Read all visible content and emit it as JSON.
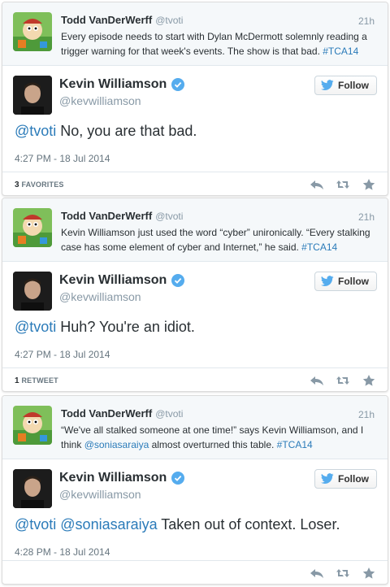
{
  "threads": [
    {
      "parent": {
        "name": "Todd VanDerWerff",
        "handle": "@tvoti",
        "time": "21h",
        "text_before": "Every episode needs to start with Dylan McDermott solemnly reading a trigger warning for that week's events. The show is that bad. ",
        "text_mention": "",
        "text_after": "",
        "hashtag": "#TCA14"
      },
      "reply": {
        "name": "Kevin Williamson",
        "handle": "@kevwilliamson",
        "follow_label": "Follow",
        "mentions": "@tvoti",
        "text": " No, you are that bad.",
        "date": "4:27 PM - 18 Jul 2014",
        "stat_count": "3",
        "stat_label": "FAVORITES"
      }
    },
    {
      "parent": {
        "name": "Todd VanDerWerff",
        "handle": "@tvoti",
        "time": "21h",
        "text_before": "Kevin Williamson just used the word “cyber” unironically. “Every stalking case has some element of cyber and Internet,” he said. ",
        "text_mention": "",
        "text_after": "",
        "hashtag": "#TCA14"
      },
      "reply": {
        "name": "Kevin Williamson",
        "handle": "@kevwilliamson",
        "follow_label": "Follow",
        "mentions": "@tvoti",
        "text": " Huh?  You're an idiot.",
        "date": "4:27 PM - 18 Jul 2014",
        "stat_count": "1",
        "stat_label": "RETWEET"
      }
    },
    {
      "parent": {
        "name": "Todd VanDerWerff",
        "handle": "@tvoti",
        "time": "21h",
        "text_before": "“We've all stalked someone at one time!” says Kevin Williamson, and I think ",
        "text_mention": "@soniasaraiya",
        "text_after": " almost overturned this table. ",
        "hashtag": "#TCA14"
      },
      "reply": {
        "name": "Kevin Williamson",
        "handle": "@kevwilliamson",
        "follow_label": "Follow",
        "mentions": "@tvoti @soniasaraiya",
        "text": " Taken out of context.  Loser.",
        "date": "4:28 PM - 18 Jul 2014",
        "stat_count": "",
        "stat_label": ""
      }
    }
  ],
  "colors": {
    "link": "#2b7bb9",
    "verified": "#55acee",
    "twitter_bird": "#55acee",
    "muted": "#8899a6"
  },
  "icons": [
    "reply-icon",
    "retweet-icon",
    "favorite-icon",
    "verified-badge-icon",
    "twitter-bird-icon"
  ]
}
